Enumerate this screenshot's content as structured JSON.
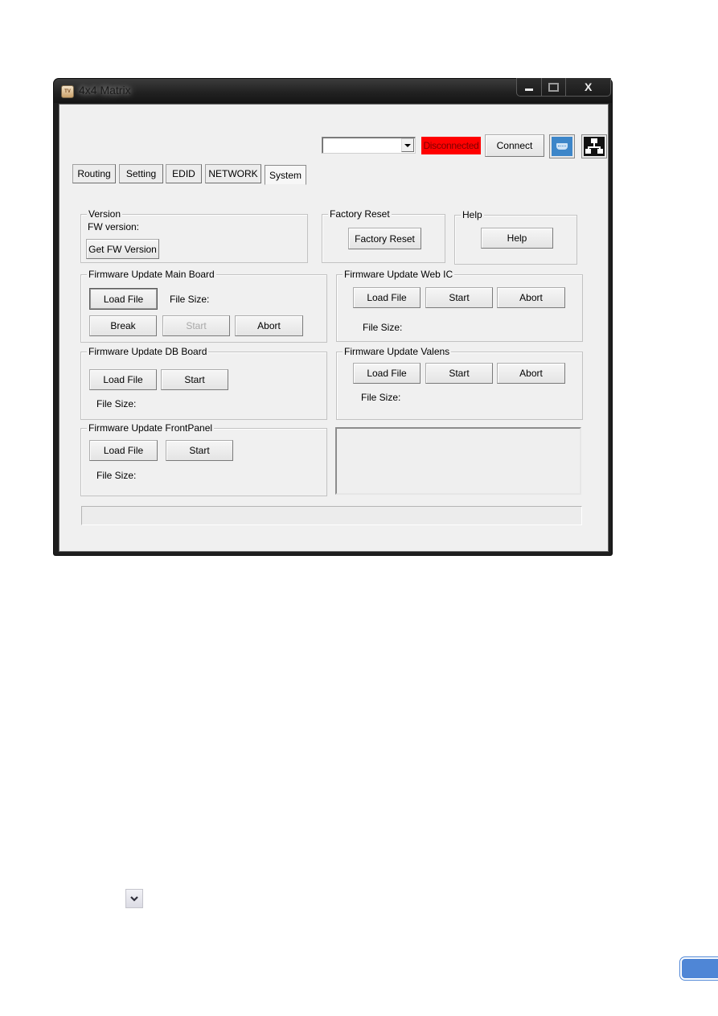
{
  "window": {
    "title": "4x4 Matrix",
    "app_icon": "tv-app-icon",
    "caption_buttons": [
      "minimize",
      "maximize",
      "close"
    ],
    "close_glyph": "X"
  },
  "toolbar": {
    "port_select": {
      "value": ""
    },
    "status": {
      "text": "Disconnected",
      "color": "#ff0000"
    },
    "connect_label": "Connect",
    "serial_icon": "serial-port-icon",
    "network_icon": "network-icon"
  },
  "tabs": [
    {
      "label": "Routing",
      "active": false
    },
    {
      "label": "Setting",
      "active": false
    },
    {
      "label": "EDID",
      "active": false
    },
    {
      "label": "NETWORK",
      "active": false
    },
    {
      "label": "System",
      "active": true
    }
  ],
  "version": {
    "title": "Version",
    "fw_label": "FW version:",
    "get_button": "Get FW Version"
  },
  "factory_reset": {
    "title": "Factory Reset",
    "button": "Factory Reset"
  },
  "help": {
    "title": "Help",
    "button": "Help"
  },
  "main_board": {
    "title": "Firmware Update Main Board",
    "load": "Load File",
    "file_size": "File Size:",
    "break": "Break",
    "start": "Start",
    "start_enabled": false,
    "abort": "Abort"
  },
  "web_ic": {
    "title": "Firmware Update Web IC",
    "load": "Load File",
    "start": "Start",
    "abort": "Abort",
    "file_size": "File Size:"
  },
  "db_board": {
    "title": "Firmware Update DB Board",
    "load": "Load File",
    "start": "Start",
    "file_size": "File Size:"
  },
  "valens": {
    "title": "Firmware Update Valens",
    "load": "Load File",
    "start": "Start",
    "abort": "Abort",
    "file_size": "File Size:"
  },
  "front_panel": {
    "title": "Firmware Update FrontPanel",
    "load": "Load File",
    "start": "Start",
    "file_size": "File Size:"
  },
  "log": {
    "text": ""
  },
  "progress": {
    "value": 0
  },
  "page": {
    "chevron_icon": "chevron-down-icon",
    "page_tab_color": "#4f86d6"
  }
}
